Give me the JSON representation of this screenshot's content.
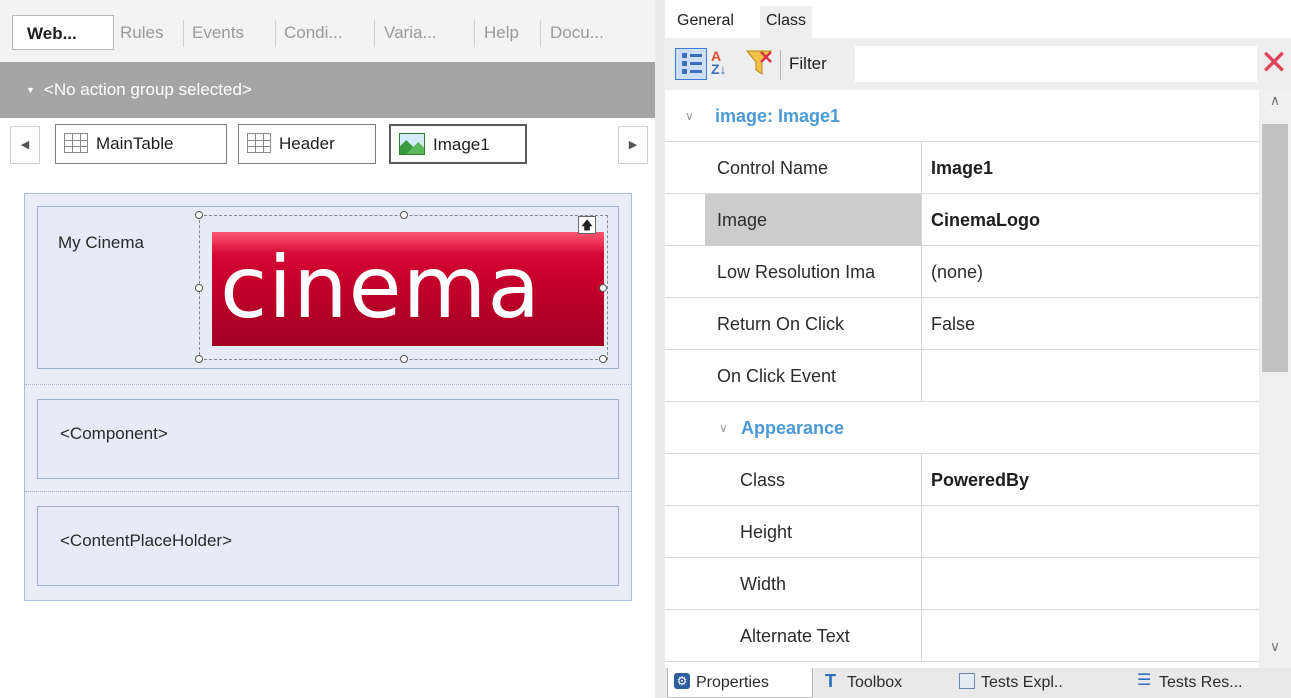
{
  "doc_tabs": [
    "Web...",
    "Rules",
    "Events",
    "Condi...",
    "Varia...",
    "Help",
    "Docu..."
  ],
  "action_group": "<No action group selected>",
  "breadcrumb": {
    "items": [
      "MainTable",
      "Header",
      "Image1"
    ]
  },
  "canvas": {
    "title_text": "My Cinema",
    "logo_text": "cinema",
    "component": "<Component>",
    "placeholder": "<ContentPlaceHolder>"
  },
  "properties": {
    "tabs": [
      "General",
      "Class"
    ],
    "filter_label": "Filter",
    "section_title": "image: Image1",
    "rows": [
      {
        "name": "Control Name",
        "value": "Image1"
      },
      {
        "name": "Image",
        "value": "CinemaLogo"
      },
      {
        "name": "Low Resolution Ima",
        "value": "(none)"
      },
      {
        "name": "Return On Click",
        "value": "False"
      },
      {
        "name": "On Click Event",
        "value": ""
      }
    ],
    "appearance": {
      "title": "Appearance",
      "rows": [
        {
          "name": "Class",
          "value": "PoweredBy"
        },
        {
          "name": "Height",
          "value": ""
        },
        {
          "name": "Width",
          "value": ""
        },
        {
          "name": "Alternate Text",
          "value": ""
        }
      ]
    },
    "ellipsis": "..."
  },
  "bottom_tabs": [
    "Properties",
    "Toolbox",
    "Tests Expl..",
    "Tests Res..."
  ],
  "colors": {
    "logo_red": "#c8002c",
    "section_blue": "#4b9ad6",
    "close_red": "#e0435c"
  },
  "icons": [
    "grid-icon",
    "image-icon",
    "categorized-icon",
    "sort-az-icon",
    "filter-icon",
    "close-icon",
    "properties-icon",
    "toolbox-icon",
    "tests-explorer-icon",
    "tests-results-icon"
  ]
}
